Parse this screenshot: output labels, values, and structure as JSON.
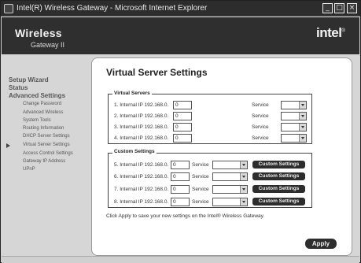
{
  "window": {
    "title": "Intel(R) Wireless Gateway - Microsoft Internet Explorer",
    "minimize": "_",
    "maximize": "□",
    "close": "×"
  },
  "banner": {
    "brand_line1": "Wireless",
    "brand_line2": "Gateway II",
    "logo_text": "intel",
    "logo_mark": "®"
  },
  "nav": {
    "setup_wizard": "Setup Wizard",
    "status": "Status",
    "advanced_settings": "Advanced Settings",
    "items": [
      "Change Password",
      "Advanced Wireless",
      "System Tools",
      "Routing Information",
      "DHCP Server Settings",
      "Virtual Server Settings",
      "Access Control Settings",
      "Gateway IP Address",
      "UPnP"
    ],
    "selected_index": 5
  },
  "main": {
    "title": "Virtual Server Settings",
    "virtual_servers": {
      "legend": "Virtual Servers",
      "rows": [
        {
          "label": "1. Internal IP 192.168.0.",
          "ip": "0",
          "service_label": "Service",
          "service_value": ""
        },
        {
          "label": "2. Internal IP 192.168.0.",
          "ip": "0",
          "service_label": "Service",
          "service_value": ""
        },
        {
          "label": "3. Internal IP 192.168.0.",
          "ip": "0",
          "service_label": "Service",
          "service_value": ""
        },
        {
          "label": "4. Internal IP 192.168.0.",
          "ip": "0",
          "service_label": "Service",
          "service_value": ""
        }
      ]
    },
    "custom_settings": {
      "legend": "Custom Settings",
      "rows": [
        {
          "label": "5. Internal IP 192.168.0.",
          "ip": "0",
          "service_label": "Service",
          "service_value": "",
          "button": "Custom Settings"
        },
        {
          "label": "6. Internal IP 192.168.0.",
          "ip": "0",
          "service_label": "Service",
          "service_value": "",
          "button": "Custom Settings"
        },
        {
          "label": "7. Internal IP 192.168.0.",
          "ip": "0",
          "service_label": "Service",
          "service_value": "",
          "button": "Custom Settings"
        },
        {
          "label": "8. Internal IP 192.168.0.",
          "ip": "0",
          "service_label": "Service",
          "service_value": "",
          "button": "Custom Settings"
        }
      ]
    },
    "note": "Click Apply to save your new settings on the Intel® Wireless Gateway.",
    "apply_label": "Apply"
  },
  "colors": {
    "title_bar": "#2d2d2d",
    "banner": "#2f2f2f",
    "nav_bg": "#d6d6d6",
    "button": "#2d2d2d"
  },
  "icons": {
    "window_icon": "ie-icon",
    "selected_marker": "arrow-right-icon"
  }
}
